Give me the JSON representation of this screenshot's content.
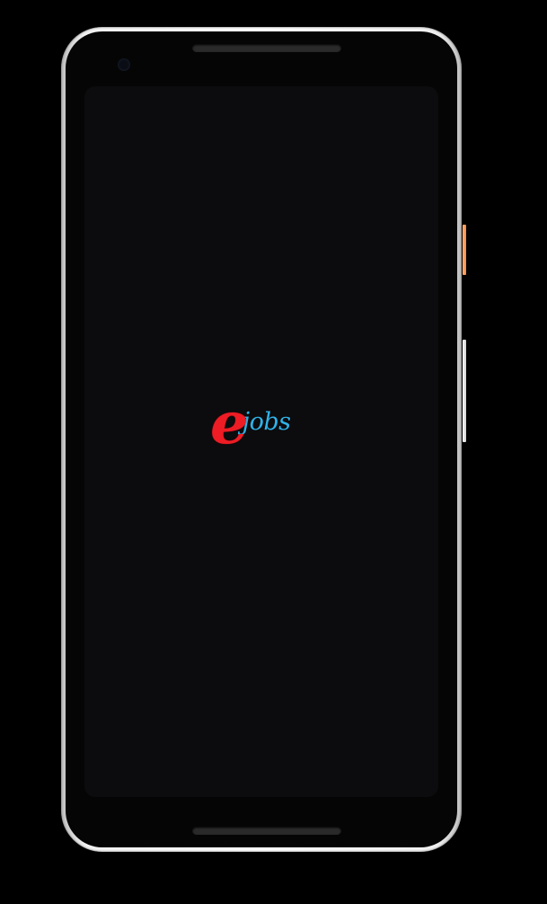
{
  "app": {
    "logo": {
      "mark": "e",
      "wordmark": "jobs",
      "mark_color": "#ee1c24",
      "wordmark_color": "#2fb3e8"
    }
  },
  "device": {
    "frame_color": "#ffffff",
    "screen_color": "#0c0b0d",
    "power_button_color": "#ff8c45"
  }
}
